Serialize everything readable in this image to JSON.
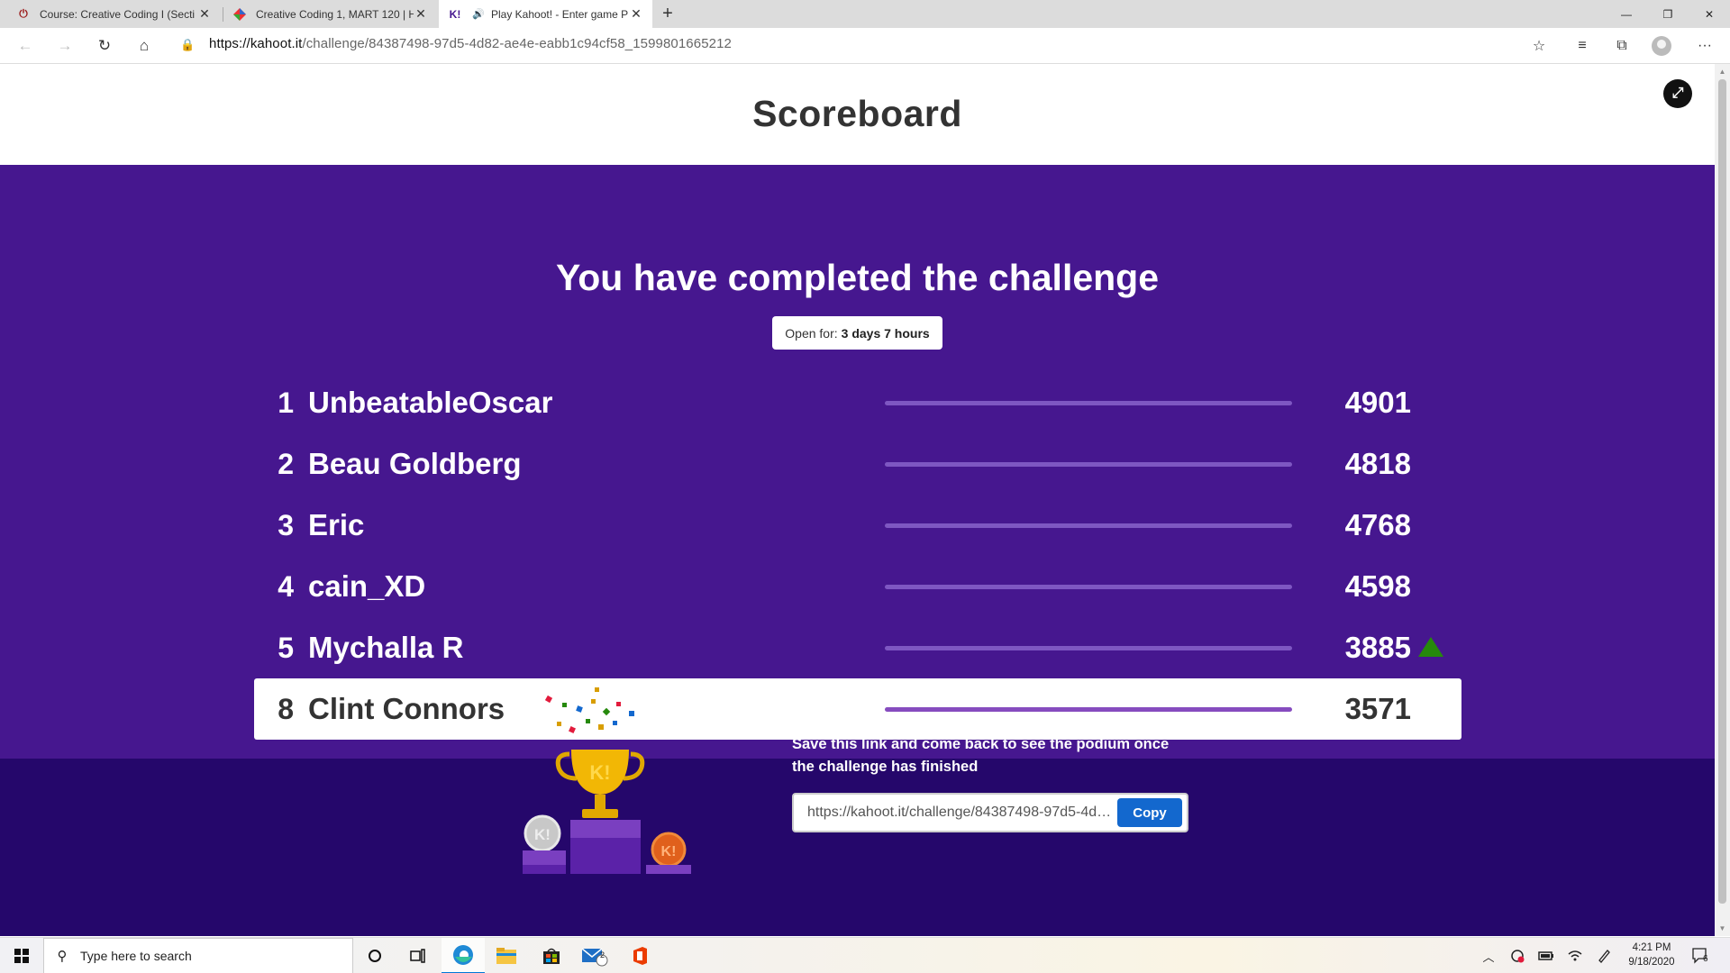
{
  "browser": {
    "tabs": [
      {
        "title": "Course: Creative Coding I (Secti",
        "icon": "power-icon",
        "active": false
      },
      {
        "title": "Creative Coding 1, MART 120 | H",
        "icon": "diamond-logo-icon",
        "active": false
      },
      {
        "title": "Play Kahoot! - Enter game P",
        "icon": "kahoot-logo-icon",
        "active": true,
        "icon_text": "K!"
      }
    ],
    "new_tab": "+",
    "url_host": "https://kahoot.it",
    "url_path": "/challenge/84387498-97d5-4d82-ae4e-eabb1c94cf58_1599801665212"
  },
  "page": {
    "title": "Scoreboard",
    "completed_heading": "You have completed the challenge",
    "open_for_label": "Open for:",
    "open_for_value": "3 days 7 hours",
    "leaderboard": [
      {
        "rank": "1",
        "name": "UnbeatableOscar",
        "score": "4901",
        "bar_fraction": 1.0
      },
      {
        "rank": "2",
        "name": "Beau Goldberg",
        "score": "4818",
        "bar_fraction": 1.0
      },
      {
        "rank": "3",
        "name": "Eric",
        "score": "4768",
        "bar_fraction": 1.0
      },
      {
        "rank": "4",
        "name": "cain_XD",
        "score": "4598",
        "bar_fraction": 1.0
      },
      {
        "rank": "5",
        "name": "Mychalla R",
        "score": "3885",
        "bar_fraction": 1.0,
        "trend": "up"
      },
      {
        "rank": "8",
        "name": "Clint Connors",
        "score": "3571",
        "bar_fraction": 1.0,
        "is_current_player": true
      }
    ],
    "save_message": "Save this link and come back to see the podium once the challenge has finished",
    "challenge_link": "https://kahoot.it/challenge/84387498-97d5-4d82-ae4e-eabb1c94cf58_1599801665212",
    "copy_label": "Copy"
  },
  "taskbar": {
    "search_placeholder": "Type here to search",
    "time": "4:21 PM",
    "date": "9/18/2020",
    "mail_badge": "2",
    "notification_badge": "6"
  },
  "colors": {
    "kahoot_purple": "#46178f",
    "footer_purple": "#25076b",
    "copy_blue": "#1368ce",
    "trend_green": "#26890c",
    "bar_purple": "#7e57c2"
  }
}
